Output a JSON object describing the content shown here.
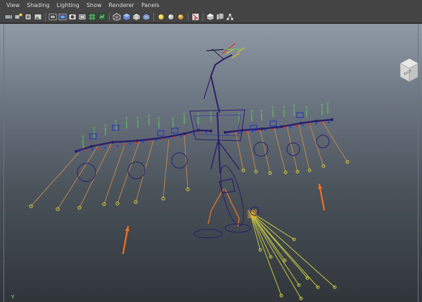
{
  "menubar": {
    "items": [
      {
        "label": "View"
      },
      {
        "label": "Shading"
      },
      {
        "label": "Lighting"
      },
      {
        "label": "Show"
      },
      {
        "label": "Renderer"
      },
      {
        "label": "Panels"
      }
    ]
  },
  "toolbar": {
    "icons": [
      "select-camera-icon",
      "camera-attributes-icon",
      "bookmark-icon",
      "image-plane-icon",
      "film-gate-icon",
      "resolution-gate-icon",
      "safe-action-icon",
      "field-chart-icon",
      "grid-icon",
      "wireframe-icon",
      "smooth-shade-icon",
      "bounding-box-icon",
      "textured-icon",
      "use-all-lights-icon",
      "shadows-icon",
      "isolate-select-icon",
      "xray-icon",
      "xray-joints-icon",
      "backface-icon"
    ]
  },
  "viewport": {
    "view_cube_label": "BACK",
    "axis_indicator": "Y",
    "colors": {
      "bone": "#2a1e6a",
      "ik_chain": "#e0702a",
      "rotate_y": "#60d060",
      "control_red": "#e03030",
      "feather_line": "#c0884a",
      "tail_line": "#c8c840",
      "annotation_arrow": "#f07020"
    }
  }
}
